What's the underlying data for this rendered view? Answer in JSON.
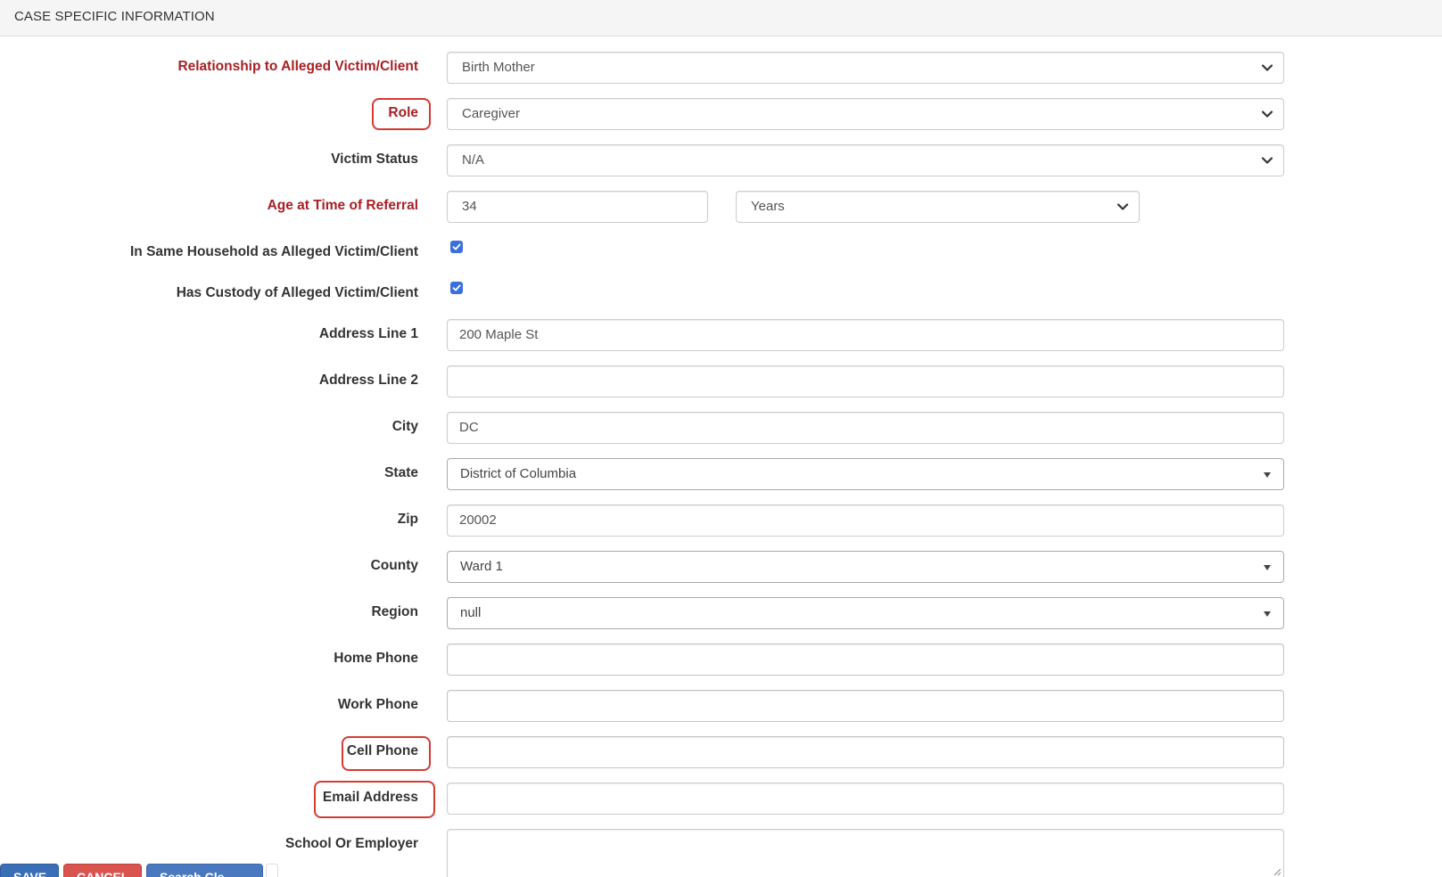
{
  "panel": {
    "title": "CASE SPECIFIC INFORMATION"
  },
  "fields": {
    "relationship": {
      "label": "Relationship to Alleged Victim/Client",
      "value": "Birth Mother"
    },
    "role": {
      "label": "Role",
      "value": "Caregiver"
    },
    "victim_status": {
      "label": "Victim Status",
      "value": "N/A"
    },
    "age": {
      "label": "Age at Time of Referral",
      "value": "34",
      "unit": "Years"
    },
    "same_household": {
      "label": "In Same Household as Alleged Victim/Client",
      "checked": true
    },
    "has_custody": {
      "label": "Has Custody of Alleged Victim/Client",
      "checked": true
    },
    "address1": {
      "label": "Address Line 1",
      "value": "200 Maple St"
    },
    "address2": {
      "label": "Address Line 2",
      "value": ""
    },
    "city": {
      "label": "City",
      "value": "DC"
    },
    "state": {
      "label": "State",
      "value": "District of Columbia"
    },
    "zip": {
      "label": "Zip",
      "value": "20002"
    },
    "county": {
      "label": "County",
      "value": "Ward 1"
    },
    "region": {
      "label": "Region",
      "value": "null"
    },
    "home_phone": {
      "label": "Home Phone",
      "value": ""
    },
    "work_phone": {
      "label": "Work Phone",
      "value": ""
    },
    "cell_phone": {
      "label": "Cell Phone",
      "value": ""
    },
    "email": {
      "label": "Email Address",
      "value": ""
    },
    "school": {
      "label": "School Or Employer",
      "value": ""
    }
  },
  "buttons": {
    "save": "SAVE",
    "cancel": "CANCEL",
    "search": "Search Cle..."
  },
  "colors": {
    "required_label": "#a81f24",
    "highlight": "#d53a32",
    "checkbox": "#3a6fe0",
    "save": "#3a6fb7",
    "cancel": "#d9534f",
    "search": "#4a79c0"
  }
}
